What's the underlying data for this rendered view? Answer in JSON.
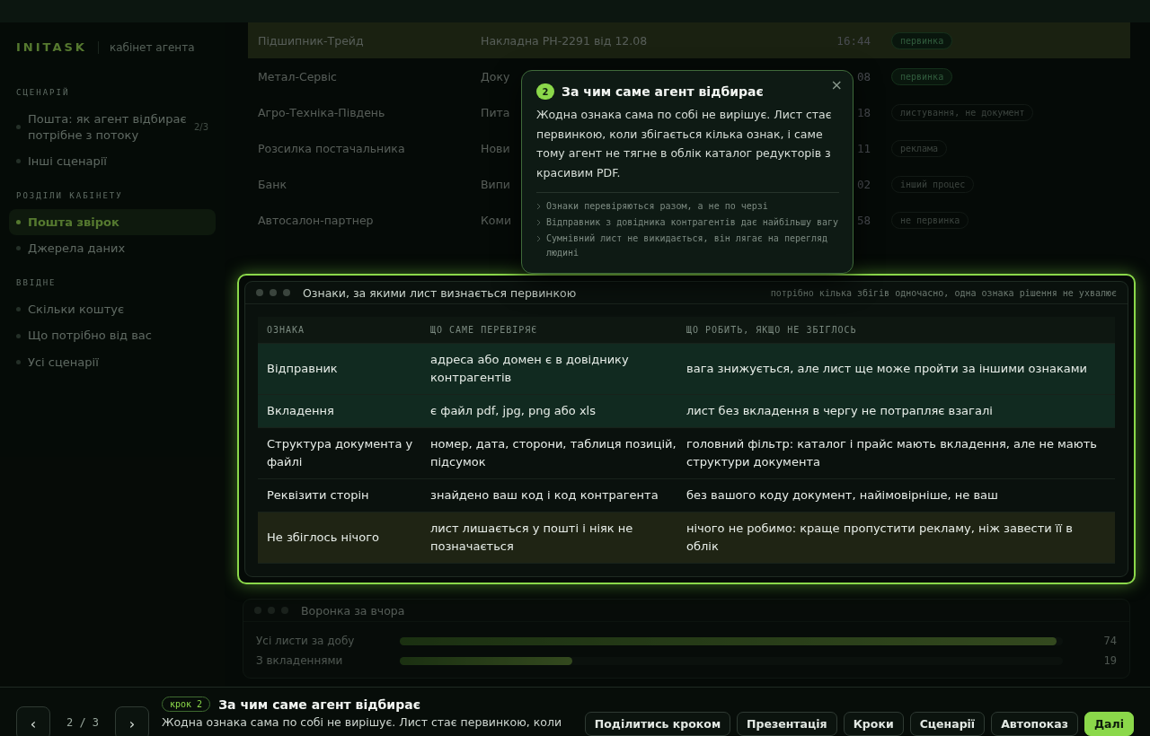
{
  "sidebar": {
    "logo": "INITASK",
    "subtitle": "кабінет агента",
    "sections": [
      {
        "title": "СЦЕНАРІЙ",
        "items": [
          {
            "label": "Пошта: як агент відбирає потрібне з потоку",
            "count": "2/3",
            "selected": false
          },
          {
            "label": "Інші сценарії",
            "selected": false
          }
        ]
      },
      {
        "title": "РОЗДІЛИ КАБІНЕТУ",
        "items": [
          {
            "label": "Пошта звірок",
            "selected": true
          },
          {
            "label": "Джерела даних",
            "selected": false
          }
        ]
      },
      {
        "title": "ВВІДНЕ",
        "items": [
          {
            "label": "Скільки коштує",
            "selected": false
          },
          {
            "label": "Що потрібно від вас",
            "selected": false
          },
          {
            "label": "Усі сценарії",
            "selected": false
          }
        ]
      }
    ]
  },
  "mail_table": {
    "rows": [
      {
        "sender": "Підшипник-Трейд",
        "document": "Накладна РН-2291 від 12.08",
        "time": "16:44",
        "tag": "первинка",
        "primary": true,
        "selected": true
      },
      {
        "sender": "Метал-Сервіс",
        "document": "Доку",
        "time": "08",
        "tag": "первинка",
        "primary": true,
        "selected": false
      },
      {
        "sender": "Агро-Техніка-Південь",
        "document": "Пита",
        "time": "18",
        "tag": "листування, не документ",
        "primary": false,
        "selected": false
      },
      {
        "sender": "Розсилка постачальника",
        "document": "Нови",
        "time": "11",
        "tag": "реклама",
        "primary": false,
        "selected": false
      },
      {
        "sender": "Банк",
        "document": "Випи",
        "time": "02",
        "tag": "інший процес",
        "primary": false,
        "selected": false
      },
      {
        "sender": "Автосалон-партнер",
        "document": "Коми",
        "time": "58",
        "tag": "не первинка",
        "primary": false,
        "selected": false
      }
    ]
  },
  "signs_card": {
    "title": "Ознаки, за якими лист визнається первинкою",
    "note": "потрібно кілька збігів одночасно, одна ознака рішення не ухвалює",
    "columns": [
      "ОЗНАКА",
      "ЩО САМЕ ПЕРЕВІРЯЄ",
      "ЩО РОБИТЬ, ЯКЩО НЕ ЗБІГЛОСЬ"
    ],
    "rows": [
      {
        "kind": "key",
        "cells": [
          "Відправник",
          "адреса або домен є в довіднику контрагентів",
          "вага знижується, але лист ще може пройти за іншими ознаками"
        ]
      },
      {
        "kind": "key",
        "cells": [
          "Вкладення",
          "є файл pdf, jpg, png або xls",
          "лист без вкладення в чергу не потрапляє взагалі"
        ]
      },
      {
        "kind": "plain",
        "cells": [
          "Структура документа у файлі",
          "номер, дата, сторони, таблиця позицій, підсумок",
          "головний фільтр: каталог і прайс мають вкладення, але не мають структури документа"
        ]
      },
      {
        "kind": "plain",
        "cells": [
          "Реквізити сторін",
          "знайдено ваш код і код контрагента",
          "без вашого коду документ, найімовірніше, не ваш"
        ]
      },
      {
        "kind": "fallback",
        "cells": [
          "Не збіглось нічого",
          "лист лишається у пошті і ніяк не позначається",
          "нічого не робимо: краще пропустити рекламу, ніж завести її в облік"
        ]
      }
    ]
  },
  "funnel_card": {
    "title": "Воронка за вчора",
    "bars": [
      {
        "label": "Усі листи за добу",
        "level": 0.99,
        "value": "74"
      },
      {
        "label": "З вкладеннями",
        "level": 0.26,
        "value": "19"
      }
    ]
  },
  "tooltip": {
    "step": "2",
    "title": "За чим саме агент відбирає",
    "text": "Жодна ознака сама по собі не вирішує. Лист стає первинкою, коли збігається кілька ознак, і саме тому агент не тягне в облік каталог редукторів з красивим PDF.",
    "close": "×",
    "points": [
      "Ознаки перевіряються разом, а не по черзі",
      "Відправник з довідника контрагентів дає найбільшу вагу",
      "Сумнівний лист не викидається, він лягає на перегляд людині"
    ]
  },
  "tour_bar": {
    "prev": "‹",
    "position": "2 / 3",
    "next": "›",
    "badge": "крок 2",
    "title": "За чим саме агент відбирає",
    "text": "Жодна ознака сама по собі не вирішує. Лист стає первинкою, коли",
    "buttons": [
      {
        "label": "Поділитись кроком",
        "primary": false
      },
      {
        "label": "Презентація",
        "primary": false
      },
      {
        "label": "Кроки",
        "primary": false
      },
      {
        "label": "Сценарії",
        "primary": false
      },
      {
        "label": "Автопоказ",
        "primary": false
      },
      {
        "label": "Далі",
        "primary": true
      }
    ]
  }
}
